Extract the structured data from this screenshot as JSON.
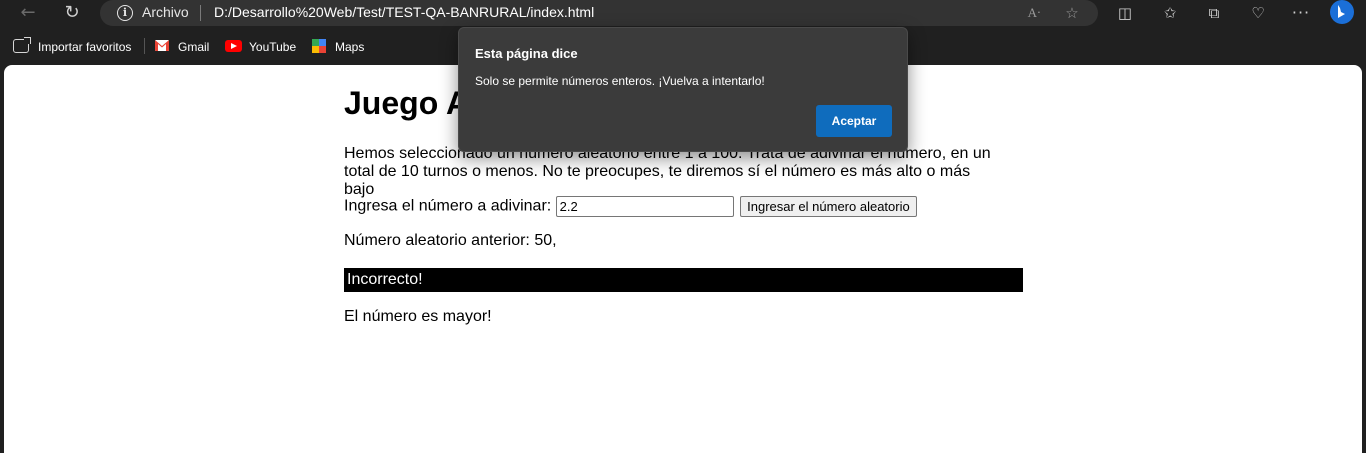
{
  "browser": {
    "secure_label": "Archivo",
    "url": "D:/Desarrollo%20Web/Test/TEST-QA-BANRURAL/index.html",
    "icons": [
      "back-arrow-icon",
      "reload-icon",
      "info-icon",
      "read-aloud-icon",
      "star-icon",
      "split-screen-icon",
      "favorites-icon",
      "collections-icon",
      "browser-essentials-icon",
      "more-icon",
      "bing-icon"
    ]
  },
  "favorites_bar": {
    "items": [
      {
        "label": "Importar favoritos",
        "icon": "import-icon"
      },
      {
        "label": "Gmail",
        "icon": "gmail-icon"
      },
      {
        "label": "YouTube",
        "icon": "youtube-icon"
      },
      {
        "label": "Maps",
        "icon": "maps-icon"
      }
    ]
  },
  "page": {
    "title": "Juego A",
    "intro": "Hemos seleccionado un número aleatorio entre 1 a 100. Trata de adivinar el número, en un total de 10 turnos o menos. No te preocupes, te diremos sí el número es más alto o más bajo",
    "guess_label": "Ingresa el número a adivinar: ",
    "guess_value": "2.2",
    "submit_label": "Ingresar el número aleatorio",
    "previous_guesses": "Número aleatorio anterior: 50,",
    "result": "Incorrecto!",
    "hint": "El número es mayor!",
    "result_bg_color": "#000000"
  },
  "dialog": {
    "title": "Esta página dice",
    "message": "Solo se permite números enteros. ¡Vuelva a intentarlo!",
    "ok_label": "Aceptar",
    "accent_color": "#0f6cbd"
  }
}
